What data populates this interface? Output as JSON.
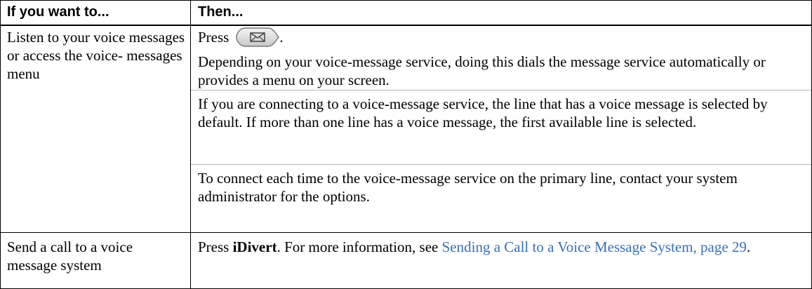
{
  "table": {
    "header": {
      "col1": "If you want to...",
      "col2": "Then..."
    },
    "rows": [
      {
        "task": "Listen to your voice messages or access the voice- messages menu",
        "steps": [
          {
            "prefix": "Press",
            "icon": "messages-button-envelope-icon",
            "suffix": "."
          },
          {
            "text": "Depending on your voice-message service, doing this dials the message service automatically or provides a menu on your screen."
          },
          {
            "text": "If you are connecting to a voice-message service, the line that has a voice message is selected by default. If more than one line has a voice message, the first available line is selected."
          },
          {
            "text": "To connect each time to the voice-message service on the primary line, contact your system administrator for the options."
          }
        ]
      },
      {
        "task": "Send a call to a voice message system",
        "steps": [
          {
            "prefix": "Press ",
            "softkey": "iDivert",
            "middle": ". For more information, see ",
            "link": "Sending a Call to a Voice Message System, page 29",
            "suffix": "."
          }
        ]
      }
    ]
  },
  "colors": {
    "link": "#3a6fb4",
    "separator": "#b8b8b8",
    "border": "#000000"
  }
}
